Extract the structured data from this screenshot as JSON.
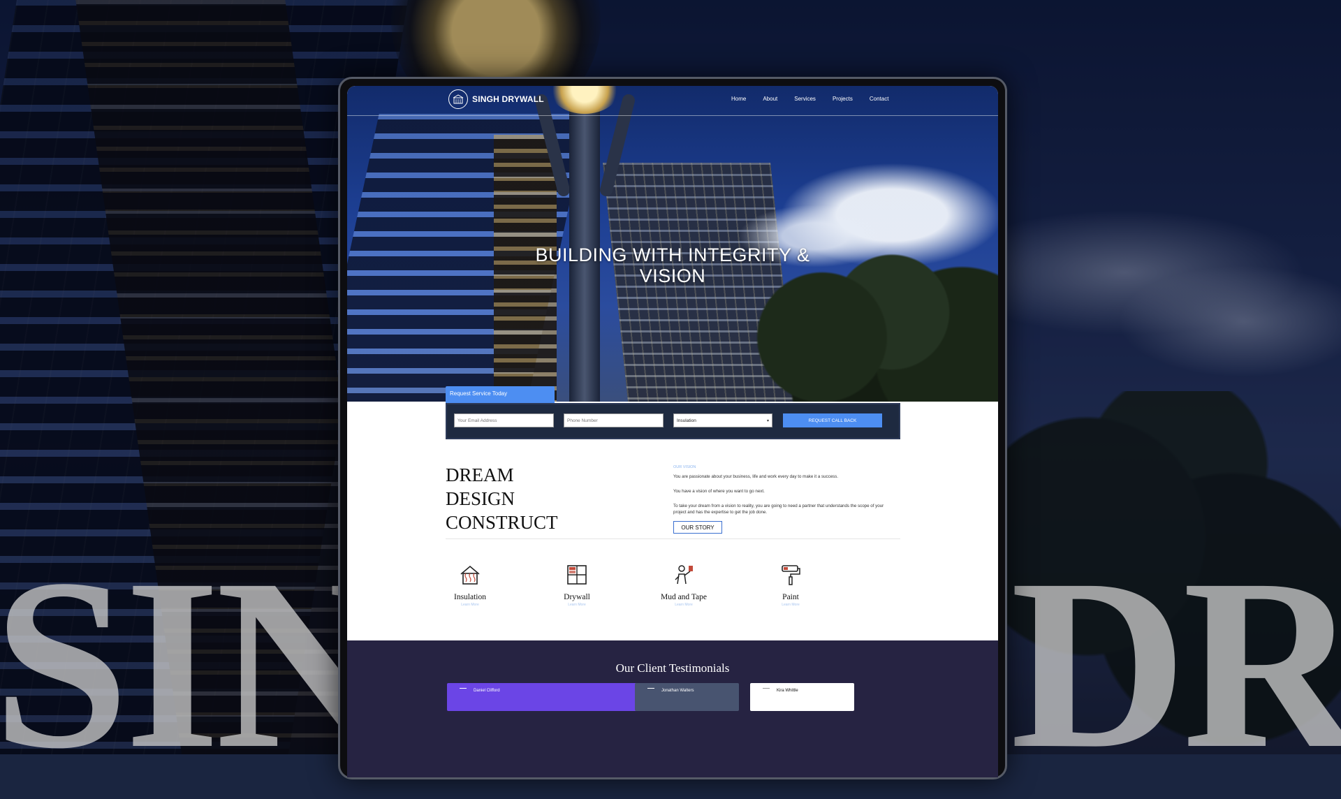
{
  "backdrop": {
    "left_letters": "SIN",
    "right_letters": "DR"
  },
  "nav": {
    "logo_text": "SINGH DRYWALL",
    "links": [
      "Home",
      "About",
      "Services",
      "Projects",
      "Contact"
    ]
  },
  "hero": {
    "title_line1": "BUILDING WITH INTEGRITY &",
    "title_line2": "VISION"
  },
  "request_form": {
    "tab_label": "Request Service Today",
    "email_placeholder": "Your Email Address",
    "phone_placeholder": "Phone Number",
    "service_selected": "Insulation",
    "submit_label": "REQUEST CALL BACK"
  },
  "intro": {
    "headline": [
      "DREAM",
      "DESIGN",
      "CONSTRUCT"
    ],
    "overline": "OUR VISION",
    "paragraphs": [
      "You are passionate about your business, life and work every day to make it a success.",
      "You have a vision of where you want to go next.",
      "To take your dream from a vision to reality, you are going to need a partner that understands the scope of your project and has the expertise to get the job done."
    ],
    "button_label": "OUR STORY"
  },
  "services": [
    {
      "name": "Insulation",
      "icon": "house-insulation-icon",
      "link": "Learn More"
    },
    {
      "name": "Drywall",
      "icon": "drywall-panel-icon",
      "link": "Learn More"
    },
    {
      "name": "Mud and Tape",
      "icon": "worker-tools-icon",
      "link": "Learn More"
    },
    {
      "name": "Paint",
      "icon": "paint-roller-icon",
      "link": "Learn More"
    }
  ],
  "testimonials": {
    "title": "Our Client Testimonials",
    "cards": [
      {
        "name": "Daniel Clifford"
      },
      {
        "name": "Jonathan Walters"
      },
      {
        "name": "Kira Whittle"
      }
    ]
  },
  "colors": {
    "accent": "#4d8ef2",
    "form_bg": "#1e2a40",
    "testimonial_bg": "#262342",
    "card_purple": "#6b45e6",
    "card_gray": "#485470"
  }
}
